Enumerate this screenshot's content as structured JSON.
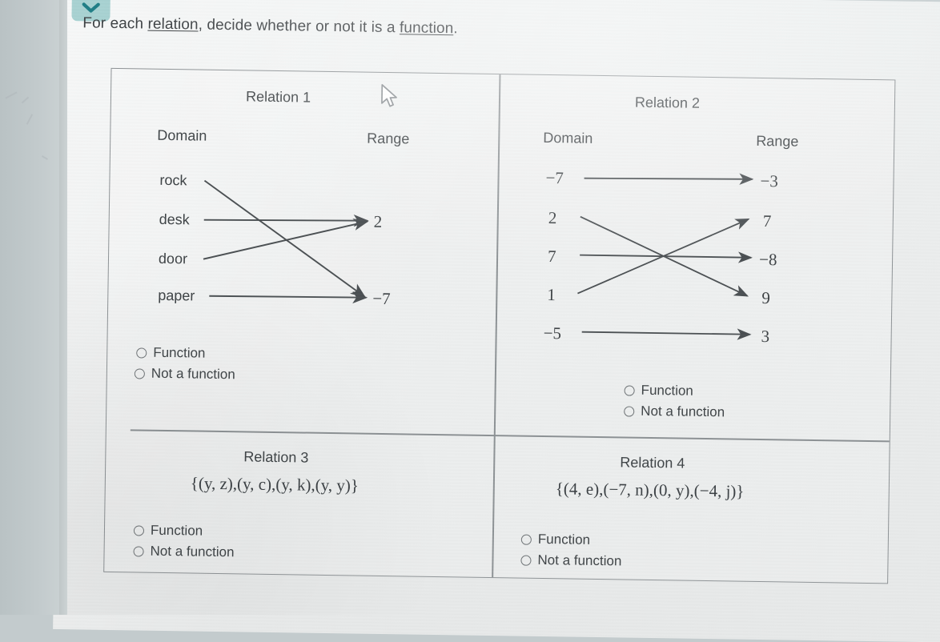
{
  "toolbar": {
    "chevron_icon": "chevron-down-icon",
    "chevron_color": "#a8d2d2"
  },
  "prompt": {
    "before": "For each ",
    "link1": "relation",
    "middle": ", decide whether or not it is a ",
    "link2": "function",
    "after": "."
  },
  "colors": {
    "ink": "#3f4447",
    "rule": "#8d9295",
    "arrow": "#4a4f52",
    "accent": "#a8d2d2",
    "page": "#eceeee"
  },
  "choices": {
    "function": "Function",
    "not_a_function": "Not a function"
  },
  "relations": [
    {
      "id": "relation-1",
      "title": "Relation 1",
      "type": "mapping",
      "domain_label": "Domain",
      "range_label": "Range",
      "domain": [
        "rock",
        "desk",
        "door",
        "paper"
      ],
      "range": [
        "2",
        "-7"
      ],
      "arrows": [
        {
          "from": "rock",
          "to": "-7"
        },
        {
          "from": "desk",
          "to": "2"
        },
        {
          "from": "door",
          "to": "2"
        },
        {
          "from": "paper",
          "to": "-7"
        }
      ],
      "selected": null
    },
    {
      "id": "relation-2",
      "title": "Relation 2",
      "type": "mapping",
      "domain_label": "Domain",
      "range_label": "Range",
      "domain": [
        "-7",
        "2",
        "7",
        "1",
        "-5"
      ],
      "range": [
        "-3",
        "7",
        "-8",
        "9",
        "3"
      ],
      "arrows": [
        {
          "from": "-7",
          "to": "-3"
        },
        {
          "from": "2",
          "to": "9"
        },
        {
          "from": "7",
          "to": "-8"
        },
        {
          "from": "1",
          "to": "7"
        },
        {
          "from": "-5",
          "to": "3"
        }
      ],
      "selected": null
    },
    {
      "id": "relation-3",
      "title": "Relation 3",
      "type": "set",
      "set_notation": "{(y, z),(y, c),(y, k),(y, y)}",
      "pairs": [
        [
          "y",
          "z"
        ],
        [
          "y",
          "c"
        ],
        [
          "y",
          "k"
        ],
        [
          "y",
          "y"
        ]
      ],
      "selected": null
    },
    {
      "id": "relation-4",
      "title": "Relation 4",
      "type": "set",
      "set_notation": "{(4, e),(-7, n),(0, y),(-4, j)}",
      "pairs": [
        [
          "4",
          "e"
        ],
        [
          "-7",
          "n"
        ],
        [
          "0",
          "y"
        ],
        [
          "-4",
          "j"
        ]
      ],
      "selected": null
    }
  ]
}
